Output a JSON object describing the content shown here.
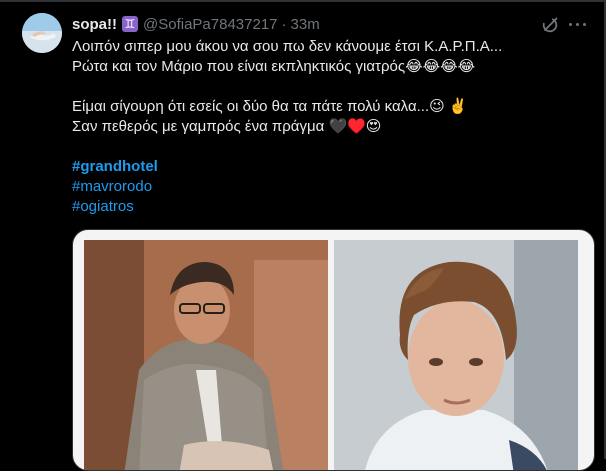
{
  "tweet": {
    "display_name": "sopa!!",
    "zodiac_badge": "♊",
    "handle": "@SofiaPa78437217",
    "separator": "·",
    "time": "33m",
    "lines": [
      "Λοιπόν σιπερ μου άκου να σου πω δεν κάνουμε έτσι Κ.Α.Ρ.Π.Α...",
      "Ρώτα και τον Μάριο που είναι εκπληκτικός γιατρός😂😂😂😂",
      "Είμαι σίγουρη ότι εσείς οι δύο θα τα πάτε πολύ καλα...😉 ✌️",
      "Σαν πεθερός με γαμπρός ένα πράγμα 🖤♥️😍"
    ],
    "hashtags": [
      "#grandhotel",
      "#mavrorodo",
      "#ogiatros"
    ]
  },
  "icons": {
    "grok": "grok-icon",
    "more": "more-icon",
    "avatar": "avatar-image"
  },
  "colors": {
    "background": "#000000",
    "text": "#e7e9ea",
    "muted": "#71767b",
    "link": "#1d9bf0",
    "border": "#2f3336"
  }
}
